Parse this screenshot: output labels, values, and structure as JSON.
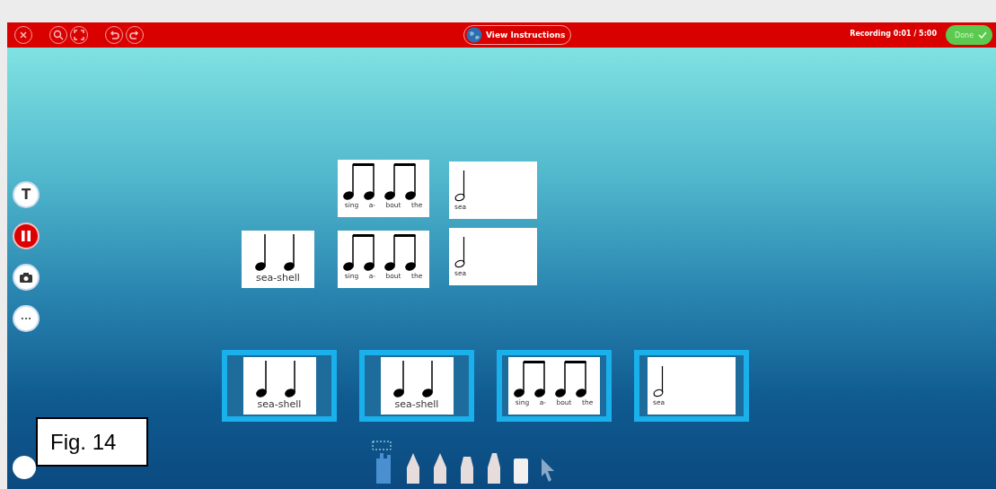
{
  "toolbar": {
    "view_instructions": "View Instructions",
    "recording": "Recording 0:01 / 5:00",
    "done_button": "Done"
  },
  "side_tools": [
    {
      "kind": "text",
      "label": "T"
    },
    {
      "kind": "pause"
    },
    {
      "kind": "camera"
    },
    {
      "kind": "more",
      "label": "···"
    }
  ],
  "cards": [
    {
      "kind": "eighths",
      "lyrics": [
        "sing",
        "a-",
        "bout",
        "the"
      ]
    },
    {
      "kind": "half",
      "lyrics": [
        "sea"
      ]
    },
    {
      "kind": "quarters",
      "lyrics": [
        "sea-shell"
      ]
    },
    {
      "kind": "eighths",
      "lyrics": [
        "sing",
        "a-",
        "bout",
        "the"
      ]
    },
    {
      "kind": "half",
      "lyrics": [
        "sea"
      ]
    }
  ],
  "slots": [
    {
      "kind": "quarters",
      "lyrics": [
        "sea-shell"
      ]
    },
    {
      "kind": "quarters",
      "lyrics": [
        "sea-shell"
      ]
    },
    {
      "kind": "eighths",
      "lyrics": [
        "sing",
        "a-",
        "bout",
        "the"
      ]
    },
    {
      "kind": "half",
      "lyrics": [
        "sea"
      ]
    }
  ],
  "bottom_tools": [
    {
      "kind": "hand"
    },
    {
      "kind": "pencil"
    },
    {
      "kind": "pencil"
    },
    {
      "kind": "marker"
    },
    {
      "kind": "highlighter"
    },
    {
      "kind": "eraser"
    },
    {
      "kind": "pointer"
    }
  ],
  "figure_label": "Fig. 14"
}
